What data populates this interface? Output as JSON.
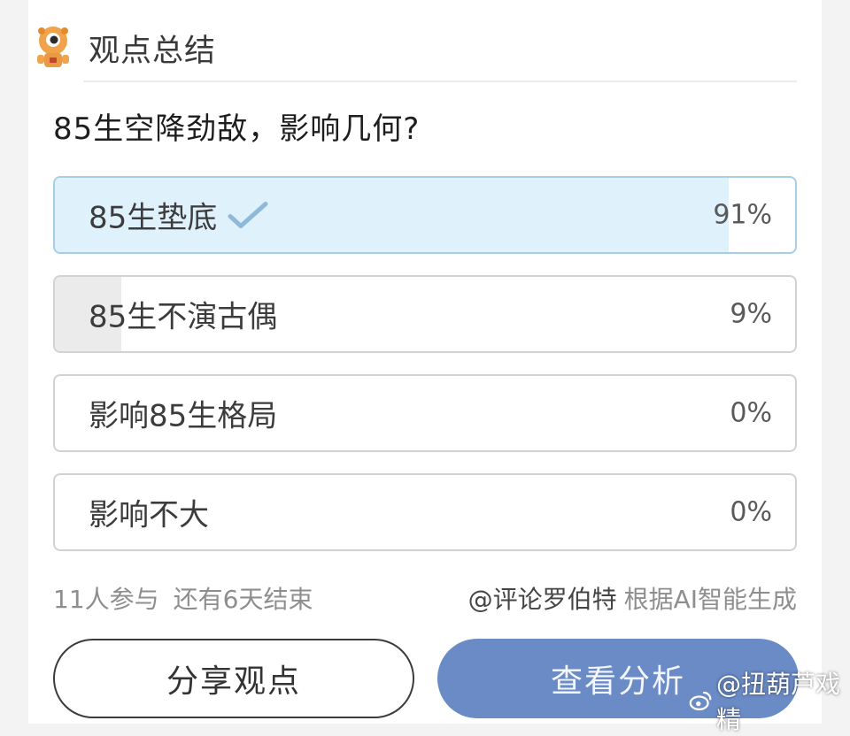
{
  "header": {
    "title": "观点总结",
    "icon": "mascot-icon"
  },
  "poll": {
    "question": "85生空降劲敌，影响几何?",
    "options": [
      {
        "label": "85生垫底",
        "percent_text": "91%",
        "percent": 91,
        "selected": true
      },
      {
        "label": "85生不演古偶",
        "percent_text": "9%",
        "percent": 9,
        "selected": false
      },
      {
        "label": "影响85生格局",
        "percent_text": "0%",
        "percent": 0,
        "selected": false
      },
      {
        "label": "影响不大",
        "percent_text": "0%",
        "percent": 0,
        "selected": false
      }
    ],
    "participants": "11人参与",
    "remaining": "还有6天结束",
    "author": "@评论罗伯特",
    "generated_note": "根据AI智能生成"
  },
  "buttons": {
    "share": "分享观点",
    "analyze": "查看分析"
  },
  "watermark": {
    "text": "@扭葫芦戏精",
    "icon": "weibo-icon"
  },
  "colors": {
    "selected_fill": "#dff1fb",
    "selected_border": "#a8cde6",
    "unselected_fill": "#ebebeb",
    "check": "#8fb9d8",
    "primary_button": "#6b8bc6"
  }
}
